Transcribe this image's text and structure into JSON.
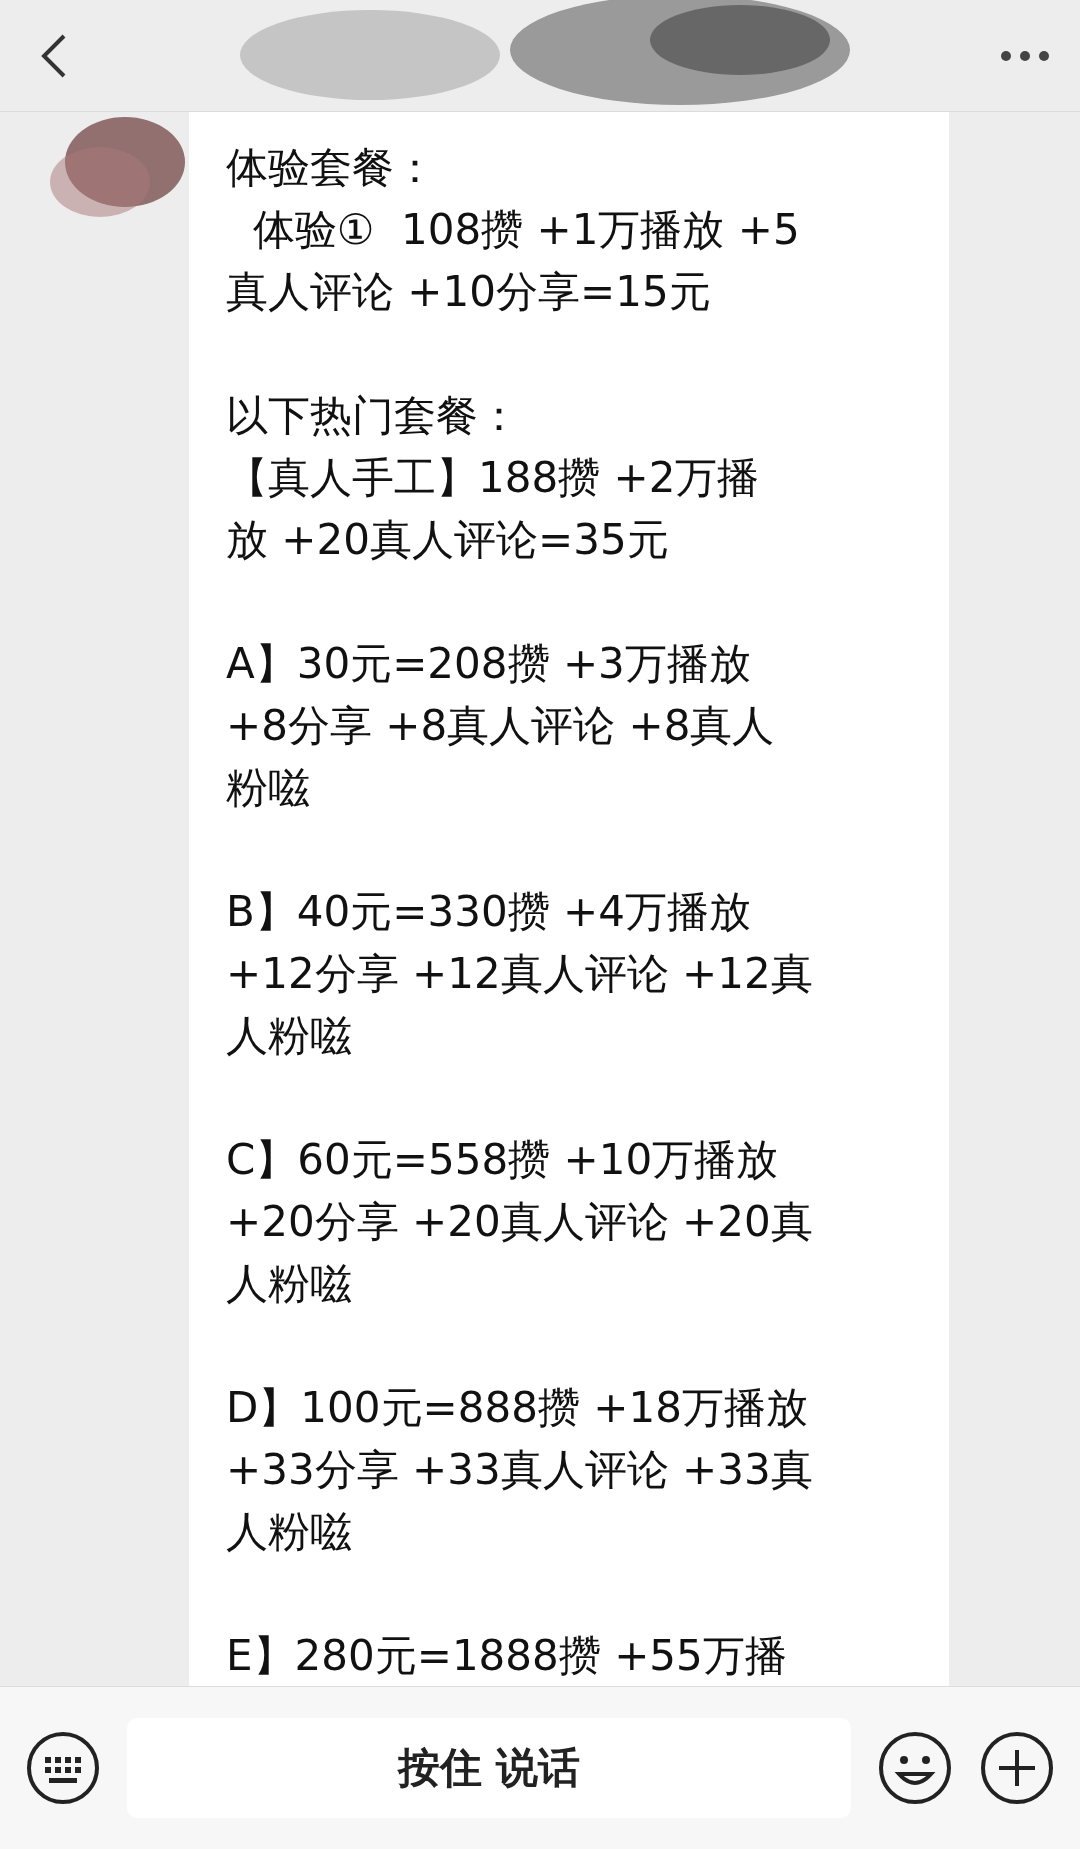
{
  "message": {
    "paragraphs": [
      [
        "体验套餐：",
        "  体验①  108攒 +1万播放 +5",
        "真人评论 +10分享=15元"
      ],
      [
        "以下热门套餐：",
        "【真人手工】188攒 +2万播",
        "放 +20真人评论=35元"
      ],
      [
        "A】30元=208攒 +3万播放",
        "+8分享 +8真人评论 +8真人",
        "粉嗞"
      ],
      [
        "B】40元=330攒 +4万播放",
        "+12分享 +12真人评论 +12真",
        "人粉嗞"
      ],
      [
        "C】60元=558攒 +10万播放",
        "+20分享 +20真人评论 +20真",
        "人粉嗞"
      ],
      [
        "D】100元=888攒 +18万播放",
        "+33分享 +33真人评论 +33真",
        "人粉嗞"
      ],
      [
        "E】280元=1888攒 +55万播"
      ]
    ]
  },
  "input_bar": {
    "hold_to_talk": "按住 说话"
  }
}
